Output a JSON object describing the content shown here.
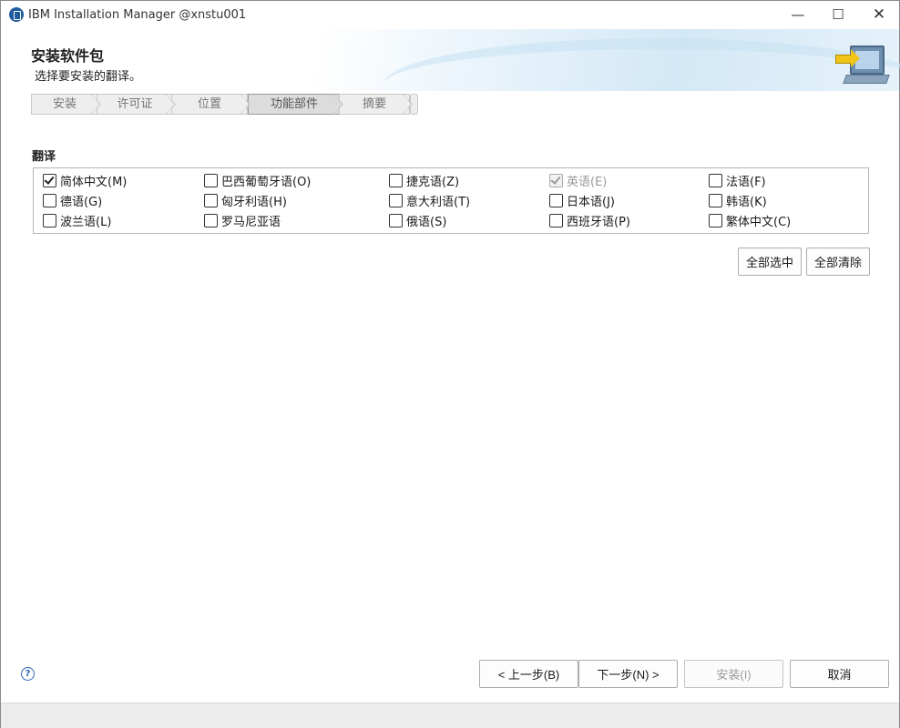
{
  "window": {
    "title": "IBM Installation Manager @xnstu001",
    "min_glyph": "—",
    "max_glyph": "☐",
    "close_glyph": "✕"
  },
  "header": {
    "title": "安装软件包",
    "subtitle": "选择要安装的翻译。"
  },
  "steps": [
    {
      "label": "安装",
      "active": false
    },
    {
      "label": "许可证",
      "active": false
    },
    {
      "label": "位置",
      "active": false
    },
    {
      "label": "功能部件",
      "active": true
    },
    {
      "label": "摘要",
      "active": false
    }
  ],
  "translations": {
    "section_title": "翻译",
    "items": [
      {
        "label": "简体中文(M)",
        "checked": true,
        "disabled": false
      },
      {
        "label": "巴西葡萄牙语(O)",
        "checked": false,
        "disabled": false
      },
      {
        "label": "捷克语(Z)",
        "checked": false,
        "disabled": false
      },
      {
        "label": "英语(E)",
        "checked": true,
        "disabled": true
      },
      {
        "label": "法语(F)",
        "checked": false,
        "disabled": false
      },
      {
        "label": "德语(G)",
        "checked": false,
        "disabled": false
      },
      {
        "label": "匈牙利语(H)",
        "checked": false,
        "disabled": false
      },
      {
        "label": "意大利语(T)",
        "checked": false,
        "disabled": false
      },
      {
        "label": "日本语(J)",
        "checked": false,
        "disabled": false
      },
      {
        "label": "韩语(K)",
        "checked": false,
        "disabled": false
      },
      {
        "label": "波兰语(L)",
        "checked": false,
        "disabled": false
      },
      {
        "label": "罗马尼亚语",
        "checked": false,
        "disabled": false
      },
      {
        "label": "俄语(S)",
        "checked": false,
        "disabled": false
      },
      {
        "label": "西班牙语(P)",
        "checked": false,
        "disabled": false
      },
      {
        "label": "繁体中文(C)",
        "checked": false,
        "disabled": false
      }
    ],
    "select_all_label": "全部选中",
    "clear_all_label": "全部清除"
  },
  "footer": {
    "help_glyph": "?",
    "back_label": "< 上一步(B)",
    "next_label": "下一步(N) >",
    "install_label": "安装(I)",
    "cancel_label": "取消"
  },
  "colors": {
    "accent_blue": "#2c64b4",
    "banner_blue": "#d3e8f6"
  }
}
